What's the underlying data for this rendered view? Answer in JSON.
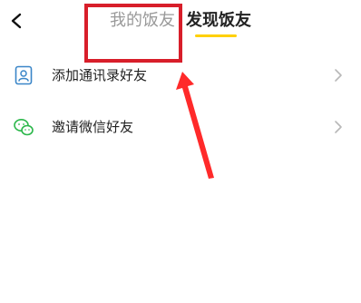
{
  "header": {
    "tabs": [
      {
        "label": "我的饭友",
        "active": false
      },
      {
        "label": "发现饭友",
        "active": true
      }
    ],
    "back_icon": "chevron-left-icon",
    "active_underline_color": "#ffd000"
  },
  "list": {
    "items": [
      {
        "label": "添加通讯录好友",
        "icon": "contact-book-icon",
        "icon_color": "#3a86c8"
      },
      {
        "label": "邀请微信好友",
        "icon": "wechat-icon",
        "icon_color": "#2bb74a"
      }
    ]
  },
  "annotation": {
    "box_color": "#d81e2a",
    "arrow_color": "#ff2a2a"
  }
}
